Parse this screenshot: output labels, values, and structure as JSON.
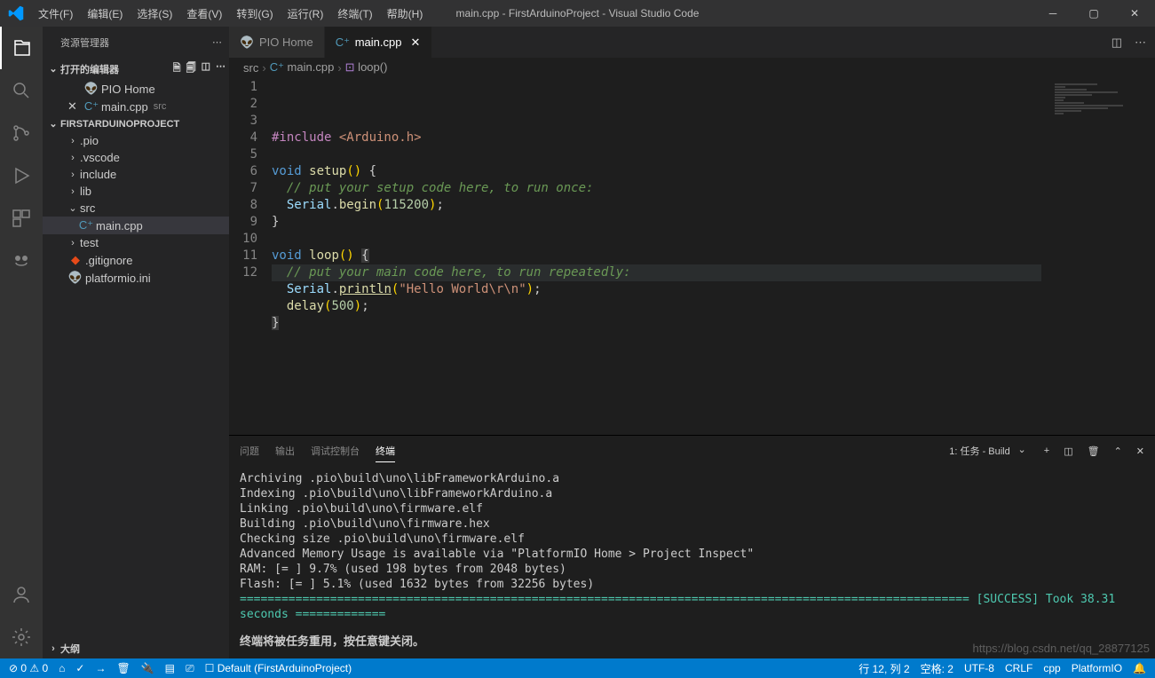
{
  "title": "main.cpp - FirstArduinoProject - Visual Studio Code",
  "menu": [
    "文件(F)",
    "编辑(E)",
    "选择(S)",
    "查看(V)",
    "转到(G)",
    "运行(R)",
    "终端(T)",
    "帮助(H)"
  ],
  "sidebar": {
    "title": "资源管理器",
    "open_editors": "打开的编辑器",
    "open_items": [
      {
        "icon": "pio",
        "label": "PIO Home",
        "close": false
      },
      {
        "icon": "cpp",
        "label": "main.cpp",
        "dim": "src",
        "close": true
      }
    ],
    "project": "FIRSTARDUINOPROJECT",
    "tree": [
      {
        "t": "folder",
        "label": ".pio"
      },
      {
        "t": "folder",
        "label": ".vscode"
      },
      {
        "t": "folder",
        "label": "include"
      },
      {
        "t": "folder",
        "label": "lib"
      },
      {
        "t": "folder",
        "label": "src",
        "open": true
      },
      {
        "t": "file",
        "label": "main.cpp",
        "icon": "cpp",
        "nested": true,
        "active": true
      },
      {
        "t": "folder",
        "label": "test"
      },
      {
        "t": "file",
        "label": ".gitignore",
        "icon": "git"
      },
      {
        "t": "file",
        "label": "platformio.ini",
        "icon": "pio"
      }
    ],
    "outline": "大纲"
  },
  "tabs": [
    {
      "icon": "pio",
      "label": "PIO Home",
      "active": false
    },
    {
      "icon": "cpp",
      "label": "main.cpp",
      "active": true
    }
  ],
  "breadcrumb": [
    "src",
    "main.cpp",
    "loop()"
  ],
  "code": {
    "lines": [
      [
        {
          "c": "p",
          "t": "#include "
        },
        {
          "c": "s",
          "t": "<Arduino.h>"
        }
      ],
      [],
      [
        {
          "c": "k",
          "t": "void "
        },
        {
          "c": "fn",
          "t": "setup"
        },
        {
          "c": "br",
          "t": "()"
        },
        {
          "t": " {"
        }
      ],
      [
        {
          "t": "  "
        },
        {
          "c": "c",
          "t": "// put your setup code here, to run once:"
        }
      ],
      [
        {
          "t": "  "
        },
        {
          "c": "m",
          "t": "Serial"
        },
        {
          "t": "."
        },
        {
          "c": "fn",
          "t": "begin"
        },
        {
          "c": "br",
          "t": "("
        },
        {
          "c": "n",
          "t": "115200"
        },
        {
          "c": "br",
          "t": ")"
        },
        {
          "t": ";"
        }
      ],
      [
        {
          "t": "}"
        }
      ],
      [],
      [
        {
          "c": "k",
          "t": "void "
        },
        {
          "c": "fn",
          "t": "loop"
        },
        {
          "c": "br",
          "t": "()"
        },
        {
          "t": " "
        },
        {
          "c": "bracket",
          "t": "{"
        }
      ],
      [
        {
          "t": "  "
        },
        {
          "c": "c",
          "t": "// put your main code here, to run repeatedly:"
        }
      ],
      [
        {
          "t": "  "
        },
        {
          "c": "m",
          "t": "Serial"
        },
        {
          "t": "."
        },
        {
          "c": "fn u",
          "t": "println"
        },
        {
          "c": "br",
          "t": "("
        },
        {
          "c": "s",
          "t": "\"Hello World\\r\\n\""
        },
        {
          "c": "br",
          "t": ")"
        },
        {
          "t": ";"
        }
      ],
      [
        {
          "t": "  "
        },
        {
          "c": "fn",
          "t": "delay"
        },
        {
          "c": "br",
          "t": "("
        },
        {
          "c": "n",
          "t": "500"
        },
        {
          "c": "br",
          "t": ")"
        },
        {
          "t": ";"
        }
      ],
      [
        {
          "c": "bracket",
          "t": "}"
        }
      ]
    ]
  },
  "panel": {
    "tabs": [
      "问题",
      "输出",
      "调试控制台",
      "终端"
    ],
    "active": 3,
    "dropdown": "1: 任务 - Build",
    "term_lines": [
      "Archiving .pio\\build\\uno\\libFrameworkArduino.a",
      "Indexing .pio\\build\\uno\\libFrameworkArduino.a",
      "Linking .pio\\build\\uno\\firmware.elf",
      "Building .pio\\build\\uno\\firmware.hex",
      "Checking size .pio\\build\\uno\\firmware.elf",
      "Advanced Memory Usage is available via \"PlatformIO Home > Project Inspect\"",
      "RAM:   [=         ]   9.7% (used 198 bytes from 2048 bytes)",
      "Flash: [=         ]   5.1% (used 1632 bytes from 32256 bytes)"
    ],
    "success_prefix": "========================================================================================================= [",
    "success": "SUCCESS",
    "success_suffix": "] Took 38.31 seconds =============",
    "closemsg": "终端将被任务重用，按任意键关闭。"
  },
  "status": {
    "left": [
      "⊘ 0 ⚠ 0"
    ],
    "left_icons": [
      "home",
      "check",
      "trash",
      "plug",
      "arrow",
      "terminal"
    ],
    "env": "Default (FirstArduinoProject)",
    "right": [
      "行 12, 列 2",
      "空格: 2",
      "UTF-8",
      "CRLF",
      "cpp",
      "PlatformIO"
    ],
    "bell": "🔔"
  },
  "watermark": "https://blog.csdn.net/qq_28877125"
}
